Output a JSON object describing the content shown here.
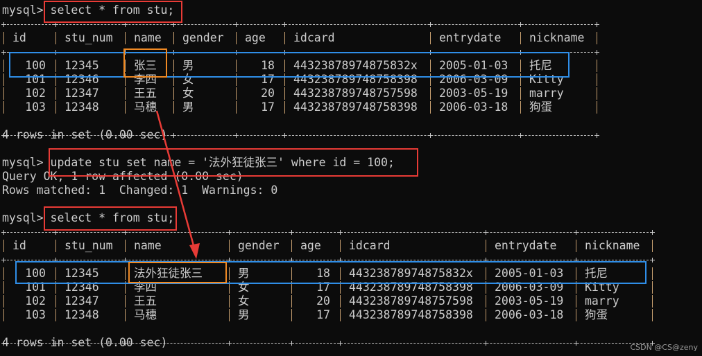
{
  "prompt": "mysql>",
  "commands": {
    "select1": "select * from stu;",
    "update": "update stu set name = '法外狂徒张三' where id = 100;",
    "select2": "select * from stu;"
  },
  "messages": {
    "rows_in_set_1": "4 rows in set (0.00 sec)",
    "query_ok": "Query OK, 1 row affected (0.00 sec)",
    "rows_matched": "Rows matched: 1  Changed: 1  Warnings: 0",
    "rows_in_set_2": "4 rows in set (0.00 sec)"
  },
  "columns": [
    "id",
    "stu_num",
    "name",
    "gender",
    "age",
    "idcard",
    "entrydate",
    "nickname"
  ],
  "table_before": [
    [
      "100",
      "12345",
      "张三",
      "男",
      "18",
      "44323878974875832x",
      "2005-01-03",
      "托尼"
    ],
    [
      "101",
      "12346",
      "李四",
      "女",
      "17",
      "443238789748758398",
      "2006-03-09",
      "Kitty"
    ],
    [
      "102",
      "12347",
      "王五",
      "女",
      "20",
      "443238789748757598",
      "2003-05-19",
      "marry"
    ],
    [
      "103",
      "12348",
      "马穗",
      "男",
      "17",
      "443238789748758398",
      "2006-03-18",
      "狗蛋"
    ]
  ],
  "table_after": [
    [
      "100",
      "12345",
      "法外狂徒张三",
      "男",
      "18",
      "44323878974875832x",
      "2005-01-03",
      "托尼"
    ],
    [
      "101",
      "12346",
      "李四",
      "女",
      "17",
      "443238789748758398",
      "2006-03-09",
      "Kitty"
    ],
    [
      "102",
      "12347",
      "王五",
      "女",
      "20",
      "443238789748757598",
      "2003-05-19",
      "marry"
    ],
    [
      "103",
      "12348",
      "马穗",
      "男",
      "17",
      "443238789748758398",
      "2006-03-18",
      "狗蛋"
    ]
  ],
  "annotation_colors": {
    "command": "#e83b36",
    "row": "#2f8ee8",
    "changed_cell": "#f08a24",
    "arrow": "#e83b36"
  },
  "watermark": "CSDN @CS@zeny"
}
